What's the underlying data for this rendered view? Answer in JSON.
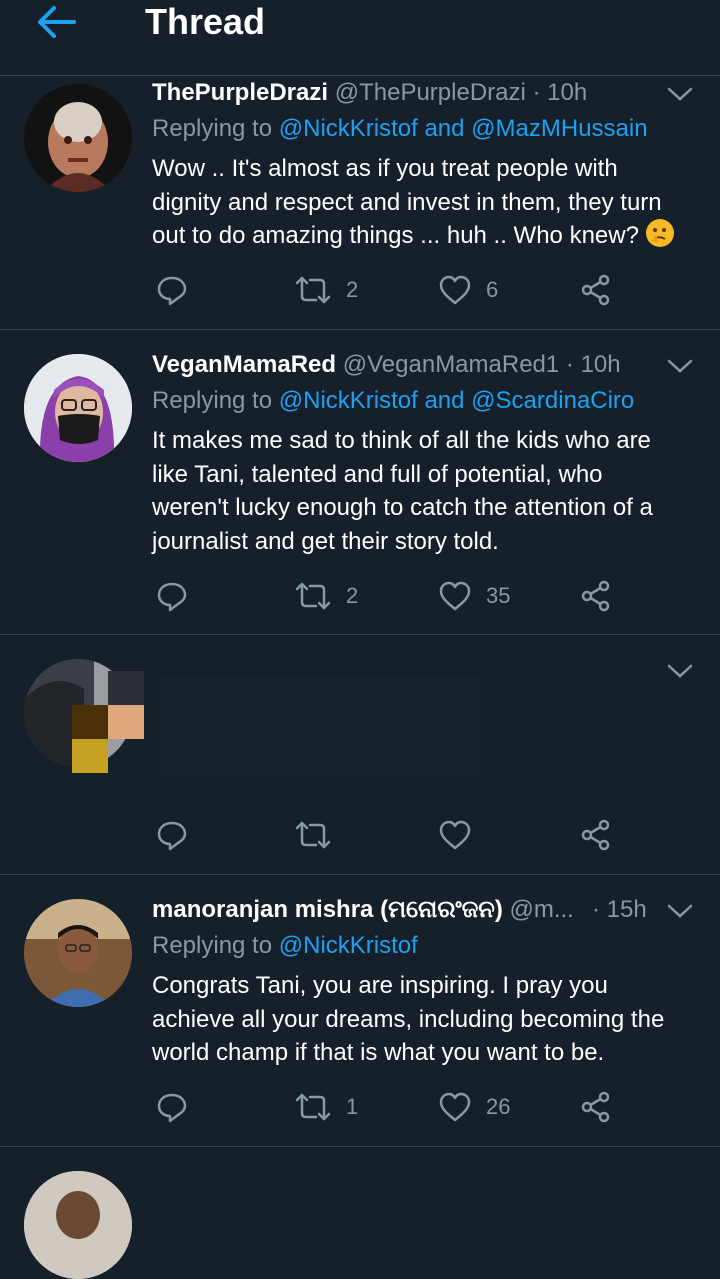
{
  "header": {
    "title": "Thread"
  },
  "tweets": [
    {
      "name": "ThePurpleDrazi",
      "handle": "@ThePurpleDrazi",
      "time": "· 10h",
      "replying_prefix": "Replying to ",
      "replying_to": "@NickKristof and @MazMHussain",
      "lines": [
        "Wow .. It's almost as if you treat people with",
        "dignity and respect and invest in them, they turn",
        "out to do amazing things ... huh .. Who knew?"
      ],
      "retweets": "2",
      "likes": "6"
    },
    {
      "name": "VeganMamaRed",
      "handle": "@VeganMamaRed1",
      "time": "· 10h",
      "replying_prefix": "Replying to ",
      "replying_to": "@NickKristof and @ScardinaCiro",
      "lines": [
        "It makes me sad to think of all the kids who are",
        "like Tani, talented and full of potential, who",
        "weren't lucky enough to catch the attention of a",
        "journalist and get their story told."
      ],
      "retweets": "2",
      "likes": "35"
    },
    {
      "name": "",
      "handle": "",
      "time": "",
      "replying_prefix": "",
      "replying_to": "",
      "lines": [],
      "retweets": "",
      "likes": ""
    },
    {
      "name": "manoranjan mishra (ମନୋରଂଜନ)",
      "handle": "@m...",
      "time": "· 15h",
      "replying_prefix": "Replying to ",
      "replying_to": "@NickKristof",
      "lines": [
        "Congrats Tani, you are inspiring. I pray you",
        "achieve all your dreams, including becoming the",
        "world champ if that is what you want to be."
      ],
      "retweets": "1",
      "likes": "26"
    }
  ],
  "icons": {
    "back": "arrow-left-icon",
    "reply": "reply-icon",
    "retweet": "retweet-icon",
    "like": "heart-icon",
    "share": "share-icon",
    "more": "chevron-down-icon"
  },
  "colors": {
    "background": "#15202b",
    "divider": "#38444d",
    "accent": "#1da1f2",
    "secondary_text": "#8899a6",
    "primary_text": "#ffffff"
  }
}
